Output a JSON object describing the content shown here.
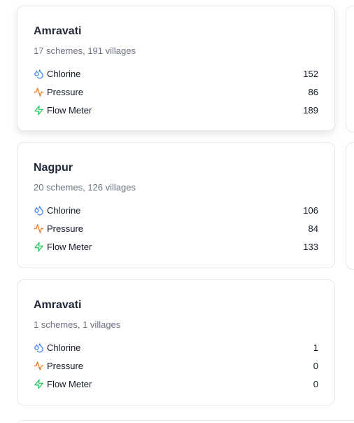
{
  "colors": {
    "chlorine": "#3b82f6",
    "pressure": "#f97316",
    "flow_meter": "#22c55e"
  },
  "cards": [
    {
      "title": "Amravati",
      "subtitle": "17 schemes, 191 villages",
      "metrics": [
        {
          "icon": "droplets-icon",
          "label": "Chlorine",
          "value": "152"
        },
        {
          "icon": "activity-icon",
          "label": "Pressure",
          "value": "86"
        },
        {
          "icon": "zap-icon",
          "label": "Flow Meter",
          "value": "189"
        }
      ]
    },
    {
      "title": "Nagpur",
      "subtitle": "20 schemes, 126 villages",
      "metrics": [
        {
          "icon": "droplets-icon",
          "label": "Chlorine",
          "value": "106"
        },
        {
          "icon": "activity-icon",
          "label": "Pressure",
          "value": "84"
        },
        {
          "icon": "zap-icon",
          "label": "Flow Meter",
          "value": "133"
        }
      ]
    },
    {
      "title": "Amravati",
      "subtitle": "1 schemes, 1 villages",
      "metrics": [
        {
          "icon": "droplets-icon",
          "label": "Chlorine",
          "value": "1"
        },
        {
          "icon": "activity-icon",
          "label": "Pressure",
          "value": "0"
        },
        {
          "icon": "zap-icon",
          "label": "Flow Meter",
          "value": "0"
        }
      ]
    }
  ]
}
